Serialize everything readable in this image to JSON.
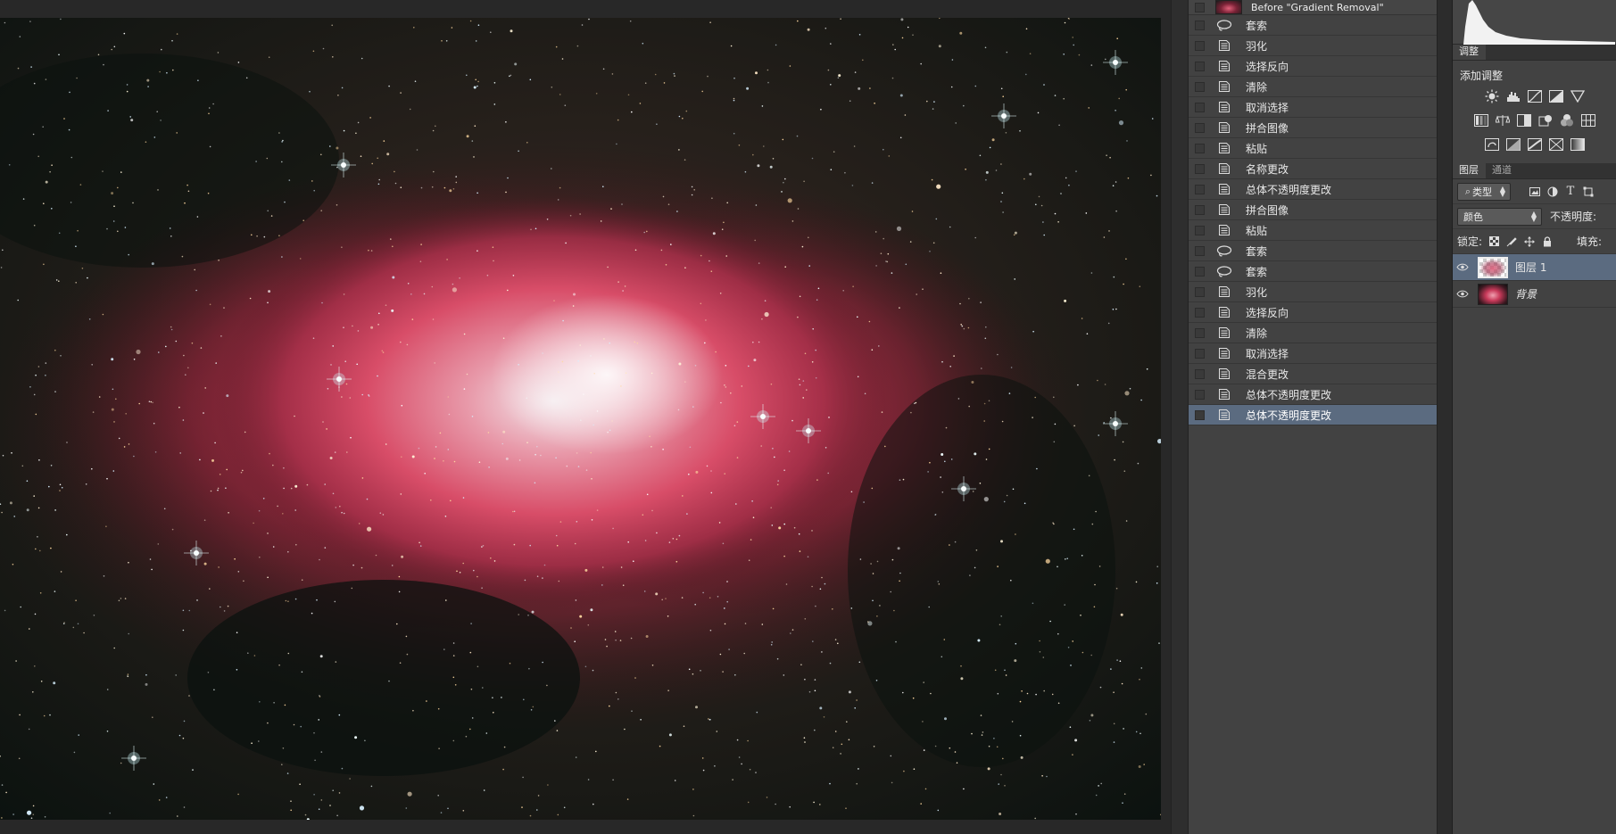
{
  "history": {
    "snapshot": {
      "label": "Before \"Gradient Removal\""
    },
    "states": [
      {
        "label": "套索",
        "icon": "lasso-icon"
      },
      {
        "label": "羽化",
        "icon": "history-state-icon"
      },
      {
        "label": "选择反向",
        "icon": "history-state-icon"
      },
      {
        "label": "清除",
        "icon": "history-state-icon"
      },
      {
        "label": "取消选择",
        "icon": "history-state-icon"
      },
      {
        "label": "拼合图像",
        "icon": "history-state-icon"
      },
      {
        "label": "粘贴",
        "icon": "history-state-icon"
      },
      {
        "label": "名称更改",
        "icon": "history-state-icon"
      },
      {
        "label": "总体不透明度更改",
        "icon": "history-state-icon"
      },
      {
        "label": "拼合图像",
        "icon": "history-state-icon"
      },
      {
        "label": "粘贴",
        "icon": "history-state-icon"
      },
      {
        "label": "套索",
        "icon": "lasso-icon"
      },
      {
        "label": "套索",
        "icon": "lasso-icon"
      },
      {
        "label": "羽化",
        "icon": "history-state-icon"
      },
      {
        "label": "选择反向",
        "icon": "history-state-icon"
      },
      {
        "label": "清除",
        "icon": "history-state-icon"
      },
      {
        "label": "取消选择",
        "icon": "history-state-icon"
      },
      {
        "label": "混合更改",
        "icon": "history-state-icon"
      },
      {
        "label": "总体不透明度更改",
        "icon": "history-state-icon"
      },
      {
        "label": "总体不透明度更改",
        "icon": "history-state-icon",
        "active": true
      }
    ]
  },
  "adjustments": {
    "tab_label": "调整",
    "add_label": "添加调整"
  },
  "layers": {
    "tab_layers": "图层",
    "tab_channels": "通道",
    "filter_kind": "类型",
    "blend_mode": "颜色",
    "opacity_label": "不透明度:",
    "lock_label": "锁定:",
    "fill_label": "填充:",
    "items": [
      {
        "name": "图层 1",
        "selected": true
      },
      {
        "name": "背景",
        "selected": false
      }
    ]
  },
  "colors": {
    "selection": "#5b6b80",
    "panel": "#424242",
    "nebula": "#d8485f"
  }
}
